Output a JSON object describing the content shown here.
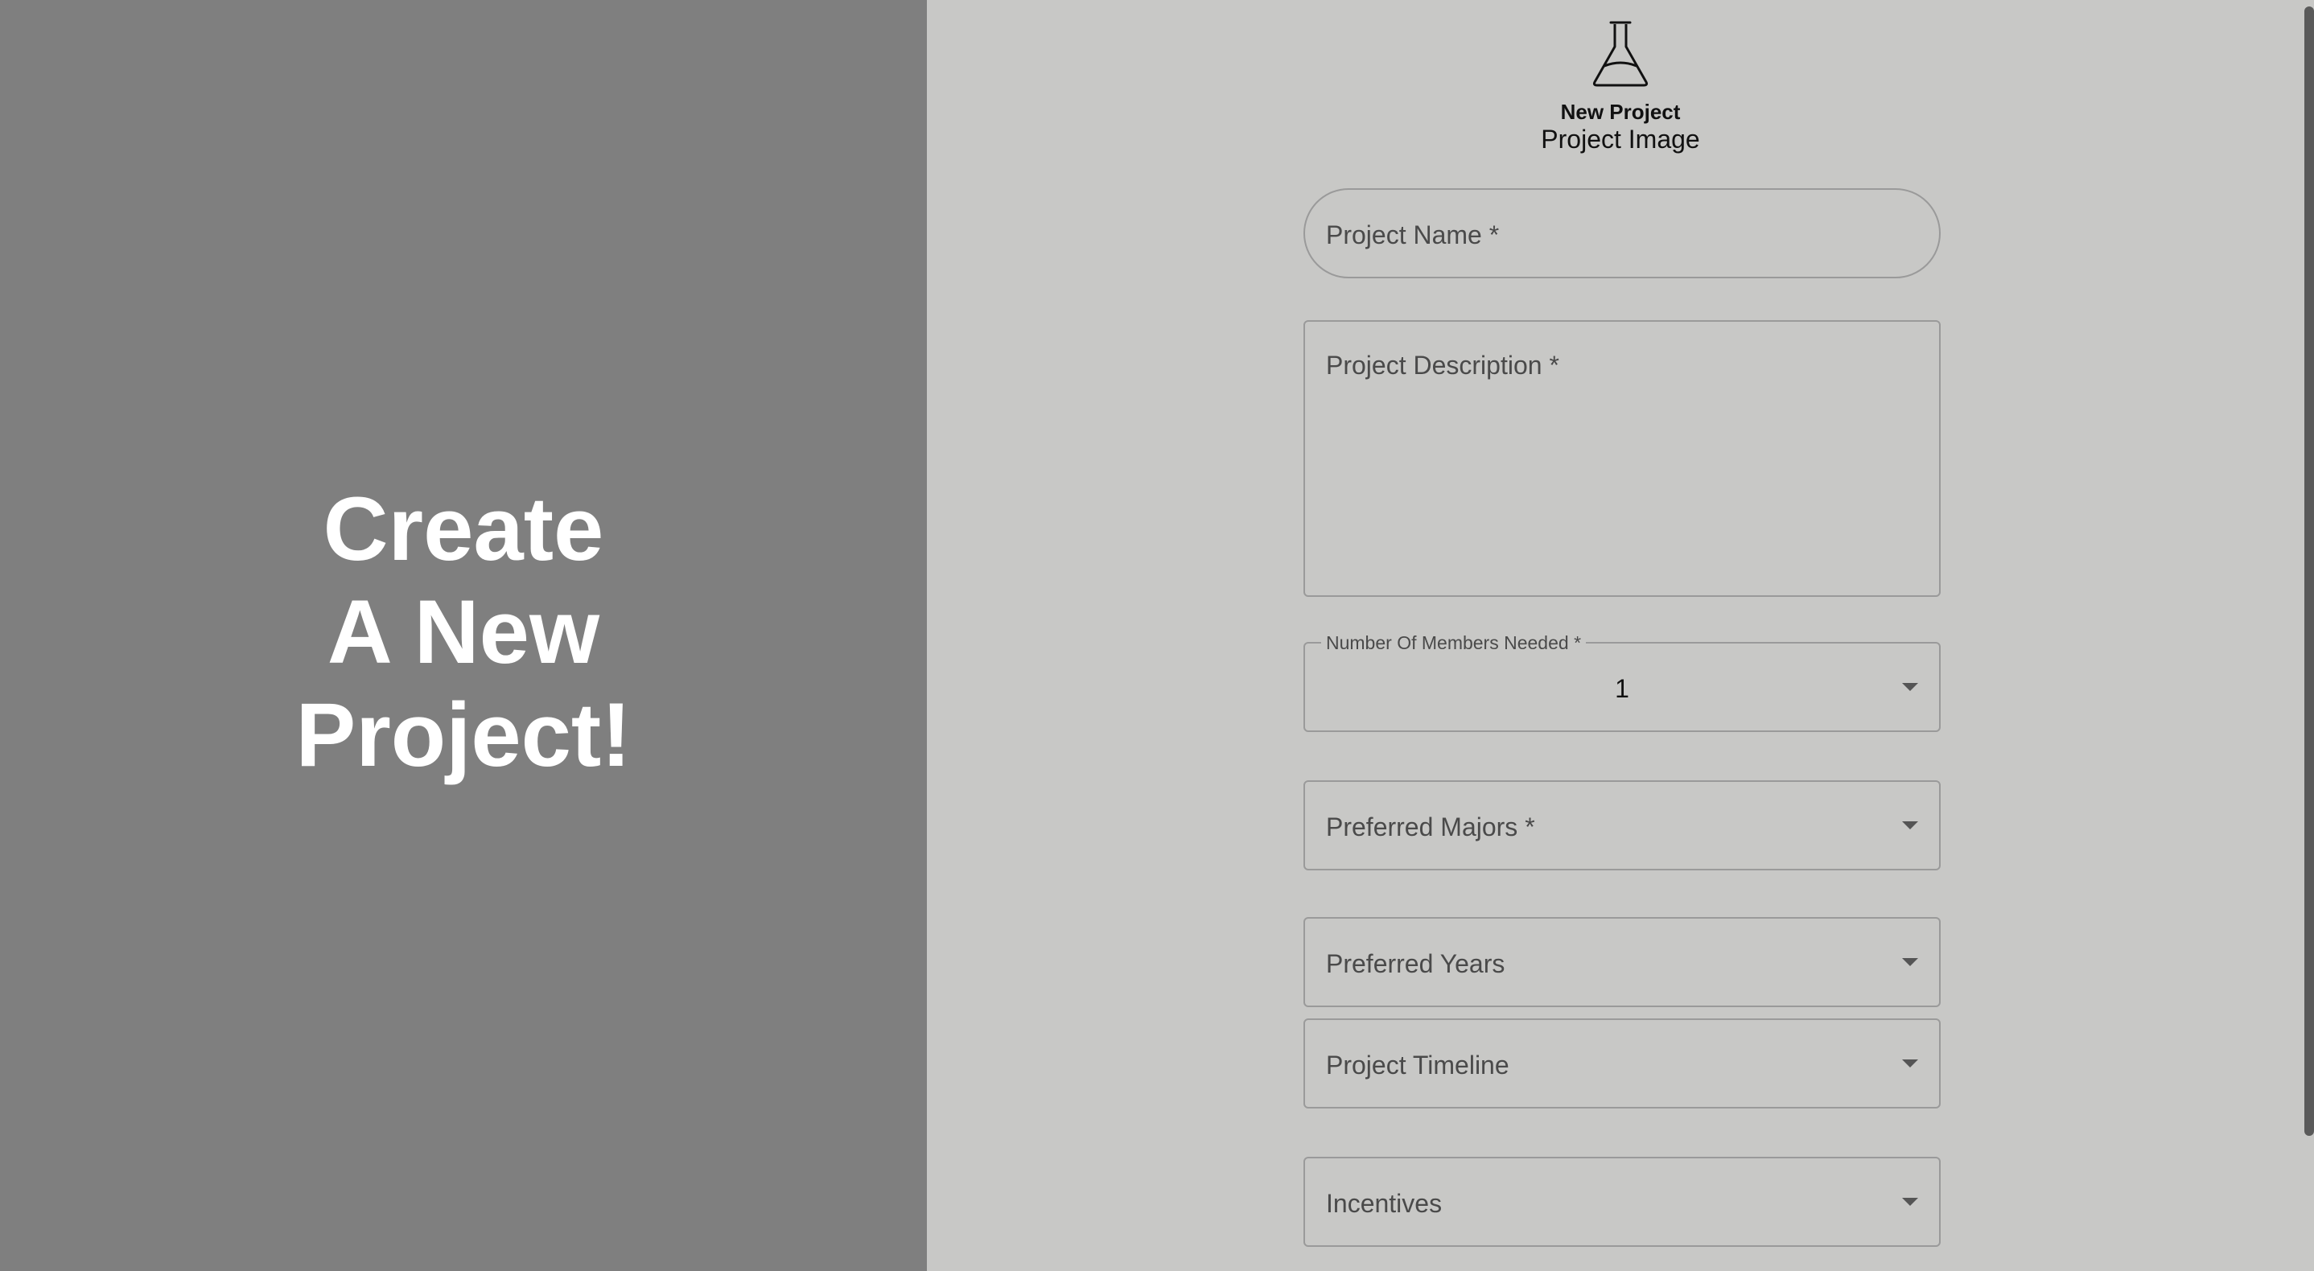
{
  "hero": {
    "line1": "Create",
    "line2": "A New",
    "line3": "Project!"
  },
  "project_image": {
    "icon": "flask-icon",
    "title": "New Project",
    "subtitle": "Project Image"
  },
  "form": {
    "project_name": {
      "label": "Project Name *",
      "value": ""
    },
    "project_description": {
      "label": "Project Description *",
      "value": ""
    },
    "members_needed": {
      "label": "Number Of Members Needed *",
      "value": "1"
    },
    "preferred_majors": {
      "label": "Preferred Majors *"
    },
    "preferred_years": {
      "label": "Preferred Years"
    },
    "project_timeline": {
      "label": "Project Timeline"
    },
    "incentives": {
      "label": "Incentives"
    }
  },
  "colors": {
    "left_panel": "#7f7f7f",
    "right_panel": "#c8c8c6",
    "field_border": "#9a9a9a"
  }
}
